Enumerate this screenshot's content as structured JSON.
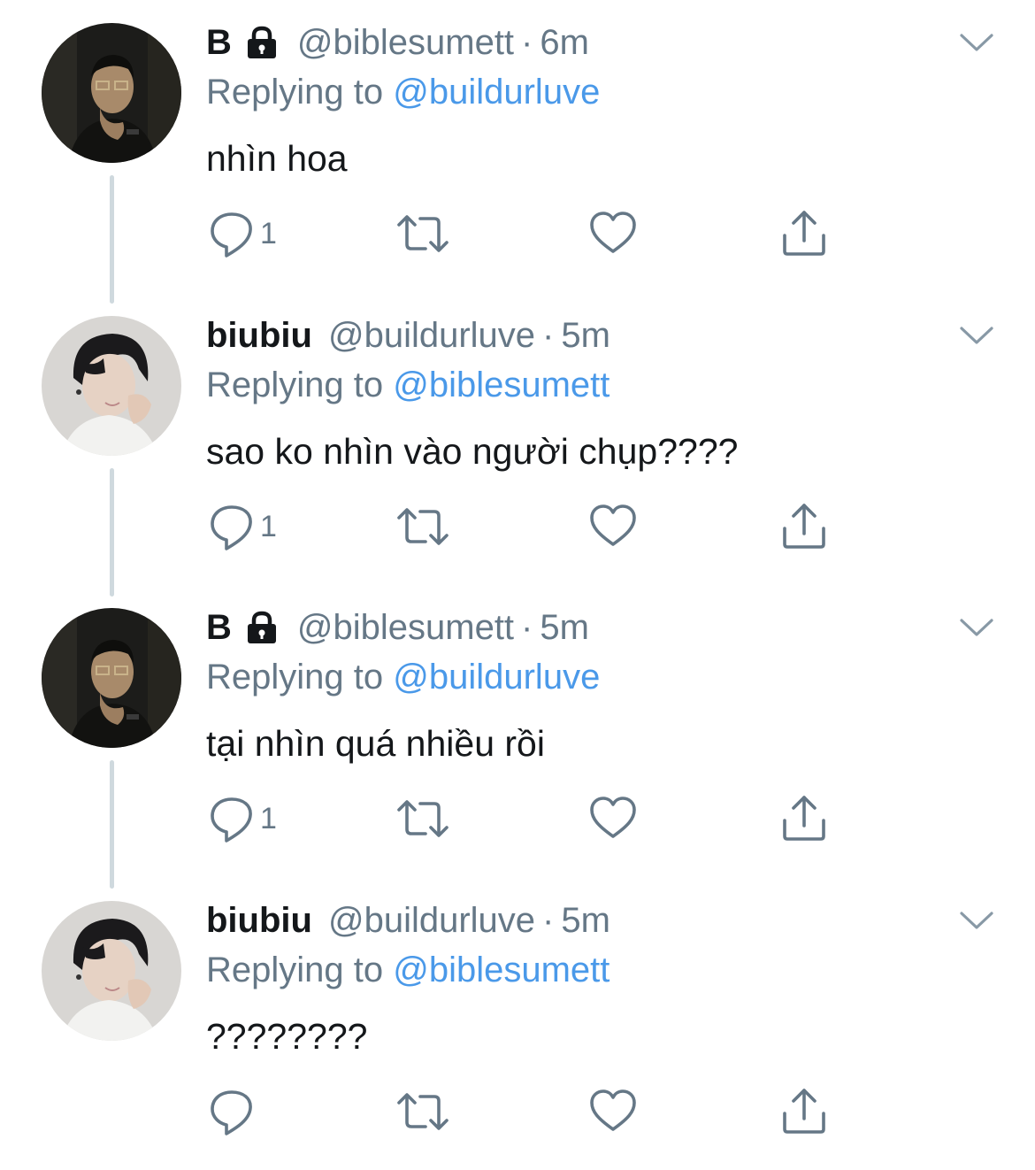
{
  "colors": {
    "text": "#14171a",
    "secondary": "#657786",
    "link": "#4a99e9",
    "thread_line": "#cfd9de"
  },
  "tweets": [
    {
      "display_name": "B",
      "protected": true,
      "handle": "@biblesumett",
      "separator": "·",
      "time": "6m",
      "replying_label": "Replying to",
      "replying_to": "@buildurluve",
      "text": "nhìn hoa",
      "reply_count": "1",
      "avatar": "avatar-b"
    },
    {
      "display_name": "biubiu",
      "protected": false,
      "handle": "@buildurluve",
      "separator": "·",
      "time": "5m",
      "replying_label": "Replying to",
      "replying_to": "@biblesumett",
      "text": "sao ko nhìn vào người chụp????",
      "reply_count": "1",
      "avatar": "avatar-biubiu"
    },
    {
      "display_name": "B",
      "protected": true,
      "handle": "@biblesumett",
      "separator": "·",
      "time": "5m",
      "replying_label": "Replying to",
      "replying_to": "@buildurluve",
      "text": "tại nhìn quá nhiều rồi",
      "reply_count": "1",
      "avatar": "avatar-b"
    },
    {
      "display_name": "biubiu",
      "protected": false,
      "handle": "@buildurluve",
      "separator": "·",
      "time": "5m",
      "replying_label": "Replying to",
      "replying_to": "@biblesumett",
      "text": "????????",
      "reply_count": "",
      "avatar": "avatar-biubiu"
    }
  ],
  "icons": {
    "caret": "chevron-down-icon",
    "reply": "reply-icon",
    "retweet": "retweet-icon",
    "like": "heart-icon",
    "share": "share-icon",
    "lock": "lock-icon"
  }
}
